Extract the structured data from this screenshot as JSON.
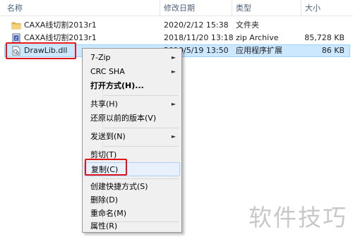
{
  "columns": {
    "name": "名称",
    "date": "修改日期",
    "type": "类型",
    "size": "大小"
  },
  "files": [
    {
      "icon": "folder-icon",
      "name": "CAXA线切割2013r1",
      "date": "2020/2/12 15:38",
      "type": "文件夹",
      "size": ""
    },
    {
      "icon": "zip-archive-icon",
      "name": "CAXA线切割2013r1",
      "date": "2018/11/20 13:18",
      "type": "zip Archive",
      "size": "85,728 KB"
    },
    {
      "icon": "dll-file-icon",
      "name": "DrawLib.dll",
      "date": "2019/5/19 13:50",
      "type": "应用程序扩展",
      "size": "86 KB"
    }
  ],
  "context_menu": {
    "items": [
      {
        "label": "7-Zip",
        "submenu": true
      },
      {
        "label": "CRC SHA",
        "submenu": true
      },
      {
        "label": "打开方式(H)...",
        "bold": true
      },
      {
        "label": "共享(H)",
        "submenu": true
      },
      {
        "label": "还原以前的版本(V)"
      },
      {
        "label": "发送到(N)",
        "submenu": true
      },
      {
        "label": "剪切(T)"
      },
      {
        "label": "复制(C)",
        "highlighted": true
      },
      {
        "label": "创建快捷方式(S)"
      },
      {
        "label": "删除(D)"
      },
      {
        "label": "重命名(M)"
      },
      {
        "label": "属性(R)"
      }
    ],
    "submenu_arrow": "►"
  },
  "watermark": "软件技巧",
  "colors": {
    "selection_bg": "#cce8ff",
    "annotation_red": "#e0161b",
    "menu_bg": "#f0f0f0"
  }
}
